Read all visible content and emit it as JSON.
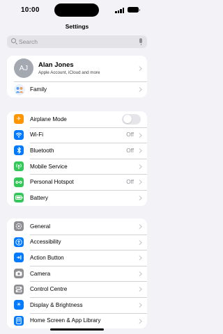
{
  "status_bar": {
    "time": "10:00"
  },
  "header": {
    "title": "Settings"
  },
  "search": {
    "placeholder": "Search"
  },
  "profile": {
    "initials": "AJ",
    "name": "Alan Jones",
    "subtitle": "Apple Account, iCloud and more",
    "family_label": "Family"
  },
  "connectivity": [
    {
      "label": "Airplane Mode",
      "icon": "airplane-icon",
      "color": "#ff9500",
      "control": "toggle",
      "on": false
    },
    {
      "label": "Wi-Fi",
      "icon": "wifi-icon",
      "color": "#007aff",
      "value": "Off"
    },
    {
      "label": "Bluetooth",
      "icon": "bluetooth-icon",
      "color": "#007aff",
      "value": "Off"
    },
    {
      "label": "Mobile Service",
      "icon": "antenna-icon",
      "color": "#34c759"
    },
    {
      "label": "Personal Hotspot",
      "icon": "hotspot-icon",
      "color": "#34c759",
      "value": "Off"
    },
    {
      "label": "Battery",
      "icon": "battery-icon",
      "color": "#34c759"
    }
  ],
  "general": [
    {
      "label": "General",
      "icon": "gear-icon",
      "color": "#8e8e93"
    },
    {
      "label": "Accessibility",
      "icon": "accessibility-icon",
      "color": "#007aff"
    },
    {
      "label": "Action Button",
      "icon": "action-button-icon",
      "color": "#007aff"
    },
    {
      "label": "Camera",
      "icon": "camera-icon",
      "color": "#8e8e93"
    },
    {
      "label": "Control Centre",
      "icon": "control-centre-icon",
      "color": "#8e8e93"
    },
    {
      "label": "Display & Brightness",
      "icon": "brightness-icon",
      "color": "#007aff"
    },
    {
      "label": "Home Screen & App Library",
      "icon": "home-screen-icon",
      "color": "#007aff"
    }
  ]
}
